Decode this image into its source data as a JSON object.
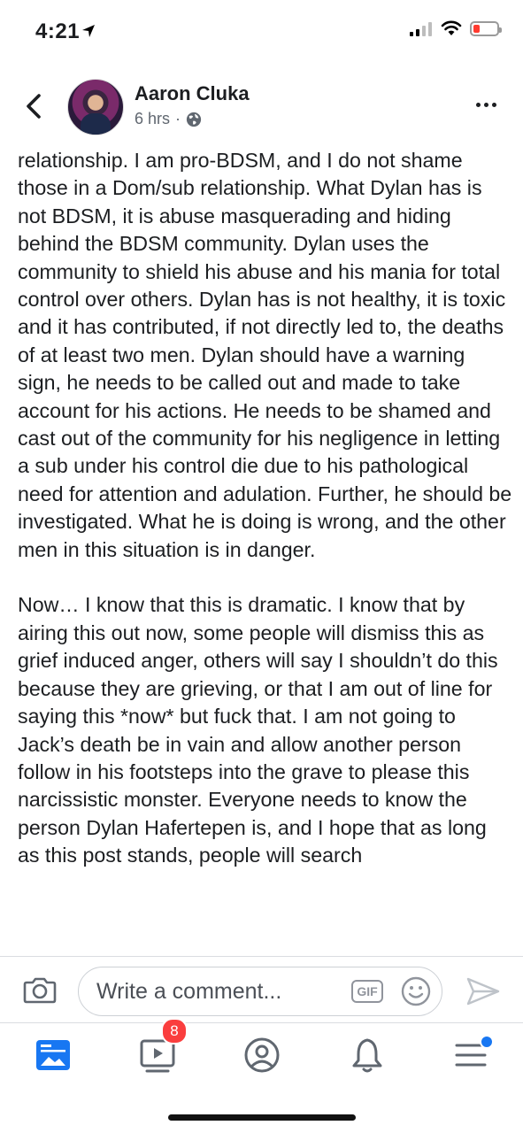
{
  "status_bar": {
    "time": "4:21"
  },
  "header": {
    "author": "Aaron Cluka",
    "timestamp": "6 hrs",
    "separator": "·"
  },
  "post": {
    "paragraphs": [
      "relationship. I am pro-BDSM, and I do not shame those in a Dom/sub relationship. What Dylan has is not BDSM, it is abuse masquerading and hiding behind the BDSM community. Dylan uses the community to shield his abuse and his mania for total control over others.  Dylan has is not healthy, it is toxic and it has contributed, if not directly led to, the deaths of at least two men. Dylan should have a warning sign, he needs to be called out and made to take account for his actions. He needs to be shamed and cast out of the community for his negligence in letting a sub under his control die due to his pathological need for attention and adulation. Further, he should be investigated. What he is doing is wrong, and the other men in this situation is in danger.",
      "Now… I know that this is dramatic. I know that by airing this out now, some people will dismiss this as grief induced anger, others will say I shouldn’t do this because they are grieving, or that I am out of line for saying this *now* but fuck that. I am not going to Jack’s death be in vain and allow another person follow in his footsteps into the grave to please this narcissistic monster. Everyone needs to know the person Dylan Hafertepen is, and I hope that as long as this post stands, people will search"
    ]
  },
  "comment_bar": {
    "placeholder": "Write a comment...",
    "gif_label": "GIF"
  },
  "tab_bar": {
    "video_badge": "8",
    "items": [
      "news-feed",
      "watch",
      "profile",
      "notifications",
      "menu"
    ]
  },
  "colors": {
    "accent": "#1877f2",
    "badge": "#fa3e3e",
    "text": "#1c1e21",
    "secondary_text": "#606770",
    "battery_low": "#ff3b30"
  }
}
